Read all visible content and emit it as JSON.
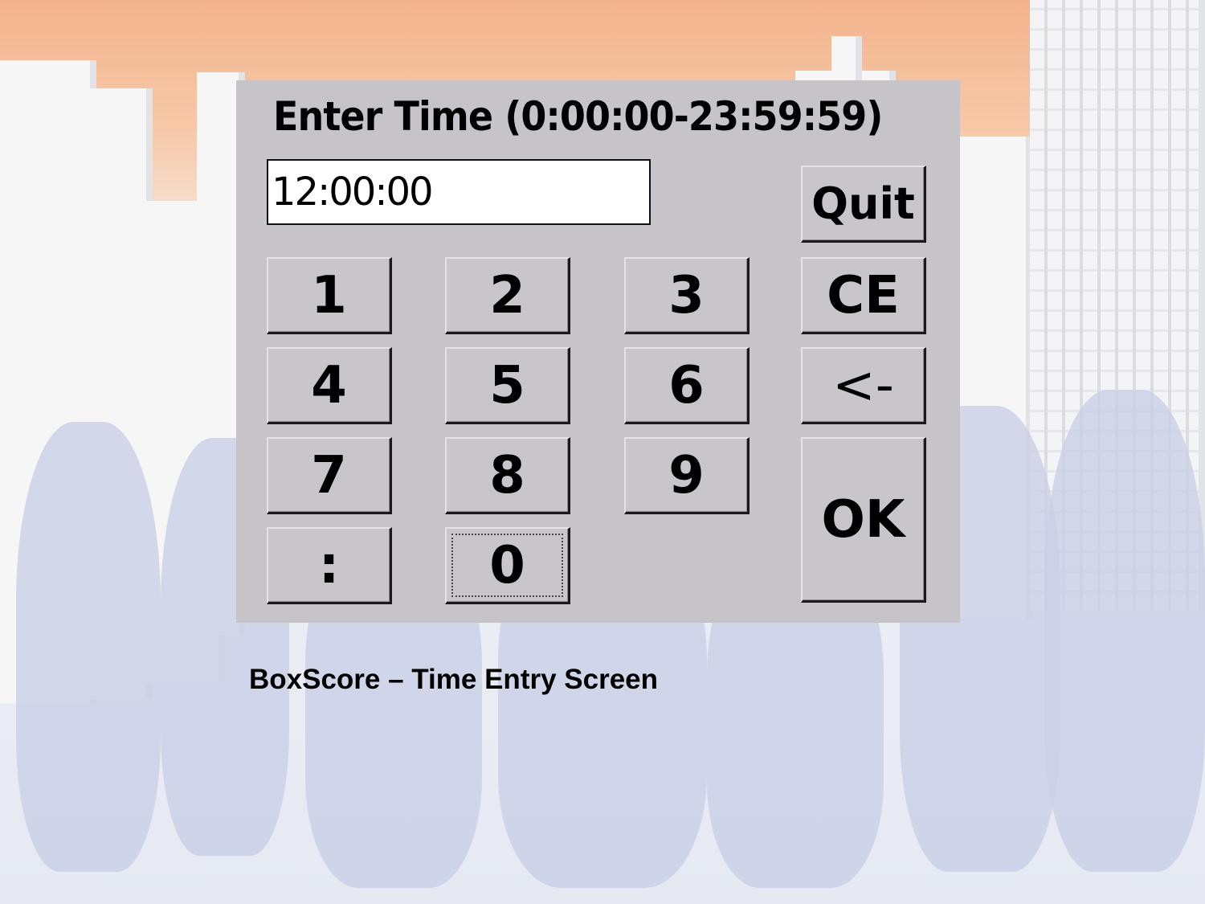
{
  "dialog": {
    "title": "Enter Time (0:00:00-23:59:59)",
    "time_input_value": "12:00:00",
    "keypad": [
      {
        "label": "1",
        "name": "key-1-button"
      },
      {
        "label": "2",
        "name": "key-2-button"
      },
      {
        "label": "3",
        "name": "key-3-button"
      },
      {
        "label": "4",
        "name": "key-4-button"
      },
      {
        "label": "5",
        "name": "key-5-button"
      },
      {
        "label": "6",
        "name": "key-6-button"
      },
      {
        "label": "7",
        "name": "key-7-button"
      },
      {
        "label": "8",
        "name": "key-8-button"
      },
      {
        "label": "9",
        "name": "key-9-button"
      },
      {
        "label": ":",
        "name": "key-colon-button"
      },
      {
        "label": "0",
        "name": "key-0-button"
      }
    ],
    "quit_label": "Quit",
    "clear_entry_label": "CE",
    "backspace_label": "<-",
    "ok_label": "OK",
    "focused_key": "0"
  },
  "caption": "BoxScore – Time Entry Screen"
}
